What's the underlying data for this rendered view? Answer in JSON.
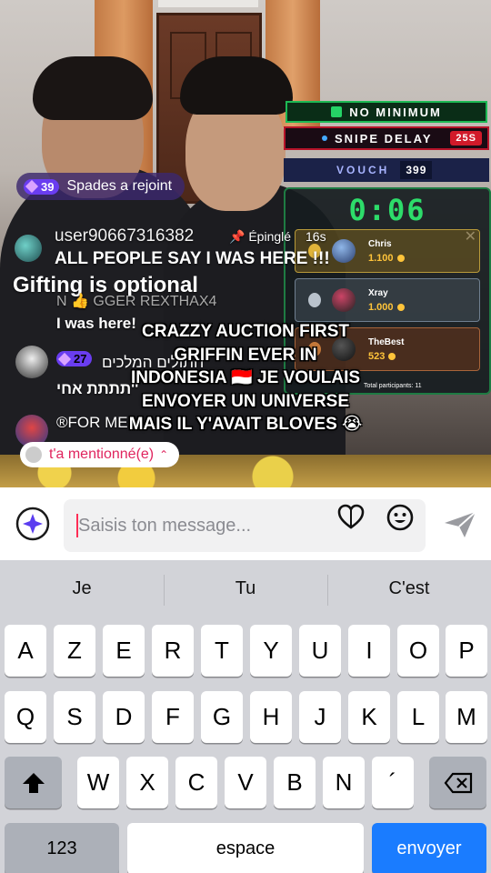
{
  "overlay": {
    "no_minimum": "NO MINIMUM",
    "snipe_delay_label": "SNIPE DELAY",
    "snipe_delay_value": "25S",
    "vouch_label": "VOUCH",
    "vouch_value": "399",
    "timer": "0:06",
    "bidders": [
      {
        "name": "Chris",
        "amount": "1.100"
      },
      {
        "name": "Xray",
        "amount": "1.000"
      },
      {
        "name": "TheBest",
        "amount": "523"
      }
    ],
    "participants": "Total participants: 11",
    "colors": {
      "green": "#2ddc6a",
      "red": "#d11a2a",
      "gold": "#ffc43a"
    }
  },
  "chat": {
    "join_badge": "39",
    "join_text": "Spades a rejoint",
    "pinned_user": "user90667316382",
    "pinned_tag": "Épinglé",
    "pinned_time": "16s",
    "pinned_message": "ALL PEOPLE SAY I WAS HERE !!!",
    "gifting": "Gifting is optional",
    "msg1_user": "N 👍 GGER REXTHAX4",
    "msg1_text": "I was here!",
    "msg2_badge": "27",
    "msg2_user": "חתולים המלכים",
    "msg2_text": "תתתת אחי''",
    "msg3_user": "®FOR ME",
    "mention_text": "t'a mentionné(e)",
    "caption": "CRAZZY AUCTION FIRST GRIFFIN EVER IN INDONESIA 🇮🇩 JE VOULAIS ENVOYER UN UNIVERSE MAIS IL Y'AVAIT BLOVES 😭"
  },
  "input": {
    "placeholder": "Saisis ton message..."
  },
  "keyboard": {
    "suggestions": [
      "Je",
      "Tu",
      "C'est"
    ],
    "row1": [
      "A",
      "Z",
      "E",
      "R",
      "T",
      "Y",
      "U",
      "I",
      "O",
      "P"
    ],
    "row2": [
      "Q",
      "S",
      "D",
      "F",
      "G",
      "H",
      "J",
      "K",
      "L",
      "M"
    ],
    "row3": [
      "W",
      "X",
      "C",
      "V",
      "B",
      "N",
      "´"
    ],
    "numbers": "123",
    "space": "espace",
    "return": "envoyer",
    "colors": {
      "return": "#1a7cff"
    }
  }
}
